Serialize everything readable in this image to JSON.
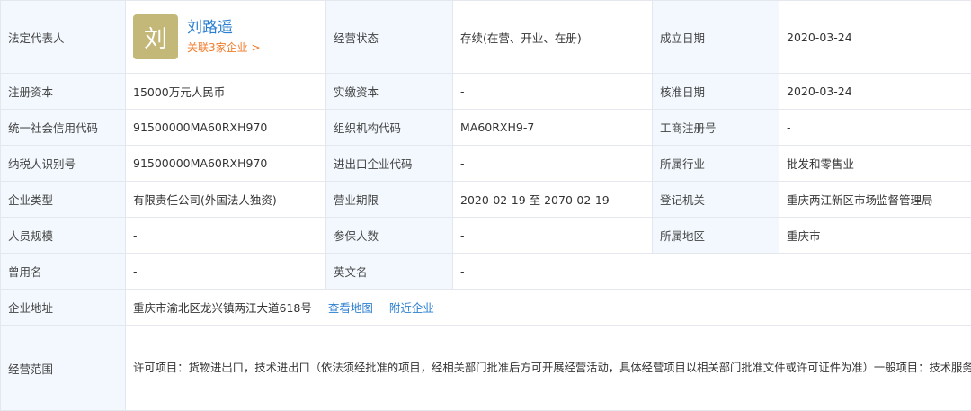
{
  "rep": {
    "label": "法定代表人",
    "avatar_char": "刘",
    "name": "刘路遥",
    "linked": "关联3家企业 >"
  },
  "status": {
    "label": "经营状态",
    "value": "存续(在营、开业、在册)"
  },
  "founded": {
    "label": "成立日期",
    "value": "2020-03-24"
  },
  "reg_capital": {
    "label": "注册资本",
    "value": "15000万元人民币"
  },
  "paid_capital": {
    "label": "实缴资本",
    "value": "-"
  },
  "approval_date": {
    "label": "核准日期",
    "value": "2020-03-24"
  },
  "credit_code": {
    "label": "统一社会信用代码",
    "value": "91500000MA60RXH970"
  },
  "org_code": {
    "label": "组织机构代码",
    "value": "MA60RXH9-7"
  },
  "biz_reg_no": {
    "label": "工商注册号",
    "value": "-"
  },
  "taxpayer_id": {
    "label": "纳税人识别号",
    "value": "91500000MA60RXH970"
  },
  "import_export": {
    "label": "进出口企业代码",
    "value": "-"
  },
  "industry": {
    "label": "所属行业",
    "value": "批发和零售业"
  },
  "company_type": {
    "label": "企业类型",
    "value": "有限责任公司(外国法人独资)"
  },
  "biz_term": {
    "label": "营业期限",
    "value": "2020-02-19 至 2070-02-19"
  },
  "reg_authority": {
    "label": "登记机关",
    "value": "重庆两江新区市场监督管理局"
  },
  "staff_size": {
    "label": "人员规模",
    "value": "-"
  },
  "insured": {
    "label": "参保人数",
    "value": "-"
  },
  "region": {
    "label": "所属地区",
    "value": "重庆市"
  },
  "former_name": {
    "label": "曾用名",
    "value": "-"
  },
  "english_name": {
    "label": "英文名",
    "value": "-"
  },
  "address": {
    "label": "企业地址",
    "value": "重庆市渝北区龙兴镇两江大道618号",
    "map_link": "查看地图",
    "nearby_link": "附近企业"
  },
  "scope": {
    "label": "经营范围",
    "value": "许可项目：货物进出口，技术进出口（依法须经批准的项目，经相关部门批准后方可开展经营活动，具体经营项目以相关部门批准文件或许可证件为准）一般项目：技术服务、技术开发、技术咨询、技术交流、技术转让、技术推广，集成电路设计，集成电路芯片设计及服务，集成电路制造，集成电路芯片及产品制造，半导体照明器件制造，半导体分立器件制造，光电子器件制造，半导体器件专用设备制造，电力电子元器件制造，电子元器件制造，通讯设备批发，通讯设备修理，计算机及通讯设备租赁，机械设备批发，机械设备租赁（除依法须经批准的项目外，凭营业执照依法自主开展经营活动）"
  },
  "colors": {
    "label_bg": "#f2f8fd",
    "border": "#e4e8ee",
    "link_blue": "#2c7fd0",
    "link_orange": "#f07b2a",
    "avatar_bg": "#c3b878"
  }
}
